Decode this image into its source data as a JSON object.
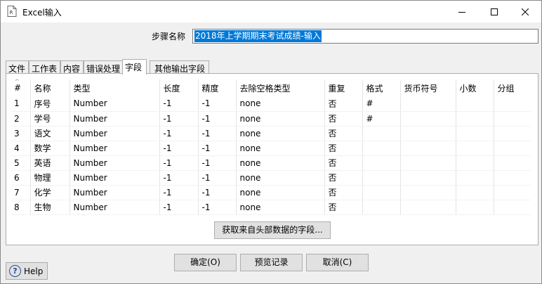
{
  "window": {
    "title": "Excel输入",
    "icon": "document-icon"
  },
  "step": {
    "label": "步骤名称",
    "value": "2018年上学期期末考试成绩-输入"
  },
  "tabs": [
    {
      "label": "文件"
    },
    {
      "label": "工作表"
    },
    {
      "label": "内容"
    },
    {
      "label": "错误处理"
    },
    {
      "label": "字段",
      "active": true
    },
    {
      "label": "其他输出字段"
    }
  ],
  "table": {
    "headers": [
      "#",
      "名称",
      "类型",
      "长度",
      "精度",
      "去除空格类型",
      "重复",
      "格式",
      "货币符号",
      "小数",
      "分组"
    ],
    "rows": [
      [
        "1",
        "序号",
        "Number",
        "-1",
        "-1",
        "none",
        "否",
        "#",
        "",
        "",
        ""
      ],
      [
        "2",
        "学号",
        "Number",
        "-1",
        "-1",
        "none",
        "否",
        "#",
        "",
        "",
        ""
      ],
      [
        "3",
        "语文",
        "Number",
        "-1",
        "-1",
        "none",
        "否",
        "",
        "",
        "",
        ""
      ],
      [
        "4",
        "数学",
        "Number",
        "-1",
        "-1",
        "none",
        "否",
        "",
        "",
        "",
        ""
      ],
      [
        "5",
        "英语",
        "Number",
        "-1",
        "-1",
        "none",
        "否",
        "",
        "",
        "",
        ""
      ],
      [
        "6",
        "物理",
        "Number",
        "-1",
        "-1",
        "none",
        "否",
        "",
        "",
        "",
        ""
      ],
      [
        "7",
        "化学",
        "Number",
        "-1",
        "-1",
        "none",
        "否",
        "",
        "",
        "",
        ""
      ],
      [
        "8",
        "生物",
        "Number",
        "-1",
        "-1",
        "none",
        "否",
        "",
        "",
        "",
        ""
      ]
    ]
  },
  "buttons": {
    "get_fields": "获取来自头部数据的字段...",
    "ok": "确定(O)",
    "preview": "预览记录",
    "cancel": "取消(C)",
    "help": "Help"
  }
}
